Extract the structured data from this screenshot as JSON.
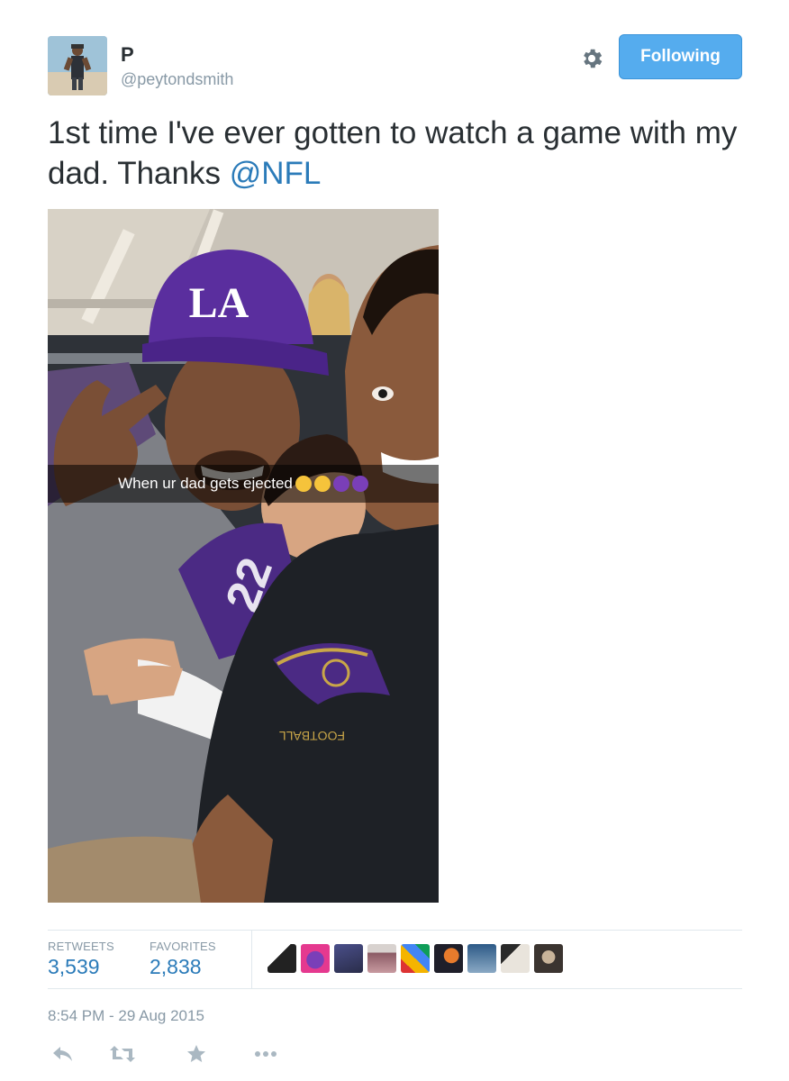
{
  "tweet": {
    "user": {
      "name": "P",
      "handle": "@peytondsmith"
    },
    "follow_button_label": "Following",
    "text_before_mention": "1st time I've ever gotten to watch a game with my dad. Thanks ",
    "mention": "@NFL",
    "photo": {
      "caption": "When ur dad gets ejected",
      "caption_emojis": [
        "face-with-tears-of-joy",
        "face-with-tears-of-joy",
        "smiling-imp",
        "smiling-imp"
      ],
      "hat_logo_text": "LA",
      "jersey_text": "FOOTBALL"
    },
    "stats": {
      "retweets_label": "RETWEETS",
      "retweets_count": "3,539",
      "favorites_label": "FAVORITES",
      "favorites_count": "2,838"
    },
    "favoriter_avatar_count": 9,
    "timestamp": "8:54 PM - 29 Aug 2015",
    "actions": [
      "reply-icon",
      "retweet-icon",
      "favorite-icon",
      "more-icon"
    ]
  },
  "colors": {
    "link_blue": "#2b7bb9",
    "follow_button_blue": "#55acee",
    "muted_gray": "#8899a6",
    "action_icon_gray": "#aab8c2",
    "emoji_yellow": "#f5c33b",
    "emoji_purple": "#7a3fb8"
  }
}
